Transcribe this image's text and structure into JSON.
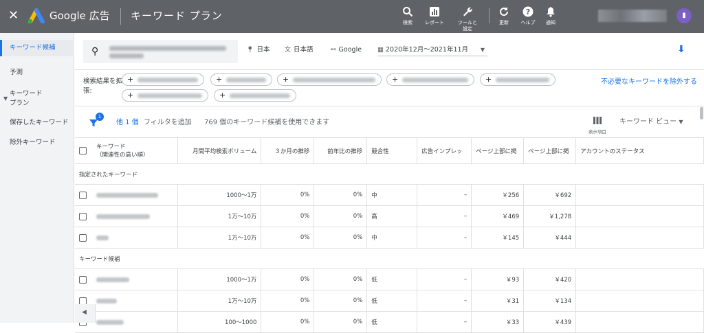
{
  "topbar": {
    "brand": "Google 広告",
    "title": "キーワード プラン",
    "tools": [
      {
        "icon": "search-icon",
        "label": "検索"
      },
      {
        "icon": "report-icon",
        "label": "レポート"
      },
      {
        "icon": "wrench-icon",
        "label": "ツールと設定"
      },
      {
        "icon": "refresh-icon",
        "label": "更新"
      },
      {
        "icon": "help-icon",
        "label": "ヘルプ"
      },
      {
        "icon": "bell-icon",
        "label": "通知"
      }
    ]
  },
  "sidebar": {
    "items": [
      {
        "label": "キーワード候補"
      },
      {
        "label": "予測"
      },
      {
        "label": "キーワード\nプラン"
      },
      {
        "label": "保存したキーワード"
      },
      {
        "label": "除外キーワード"
      }
    ]
  },
  "search": {
    "location": "日本",
    "language": "日本語",
    "network": "Google",
    "date_range": "2020年12月～2021年11月"
  },
  "expand": {
    "label": "検索結果を拡張:",
    "unneeded": "不必要なキーワードを除外する"
  },
  "filterbar": {
    "badge": "1",
    "one_filter": "他 1 個",
    "add_filter": "フィルタを追加",
    "count_text": "769 個のキーワード候補を使用できます",
    "columns_label": "表示項目",
    "view": "キーワード ビュー"
  },
  "table": {
    "headers": [
      "キーワード\n（関連性の高い順）",
      "月間平均検索ボリューム",
      "３か月の推移",
      "前年比の推移",
      "競合性",
      "広告インプレッ",
      "ページ上部に掲",
      "ページ上部に掲",
      "アカウントのステータス"
    ],
    "section1": "指定されたキーワード",
    "section2": "キーワード候補",
    "rows1": [
      {
        "volume": "1000～1万",
        "m3": "0%",
        "yoy": "0%",
        "comp": "中",
        "imp": "–",
        "low": "￥256",
        "high": "￥692"
      },
      {
        "volume": "1万～10万",
        "m3": "0%",
        "yoy": "0%",
        "comp": "高",
        "imp": "–",
        "low": "￥469",
        "high": "￥1,278"
      },
      {
        "volume": "1万～10万",
        "m3": "0%",
        "yoy": "0%",
        "comp": "中",
        "imp": "–",
        "low": "￥145",
        "high": "￥444"
      }
    ],
    "rows2": [
      {
        "volume": "1000～1万",
        "m3": "0%",
        "yoy": "0%",
        "comp": "低",
        "imp": "–",
        "low": "￥93",
        "high": "￥420"
      },
      {
        "volume": "1万～10万",
        "m3": "0%",
        "yoy": "0%",
        "comp": "低",
        "imp": "–",
        "low": "￥31",
        "high": "￥134"
      },
      {
        "volume": "100～1000",
        "m3": "0%",
        "yoy": "0%",
        "comp": "低",
        "imp": "–",
        "low": "￥33",
        "high": "￥439"
      }
    ]
  },
  "colors": {
    "topbar": "#5f6368",
    "accent": "#1a73e8"
  }
}
